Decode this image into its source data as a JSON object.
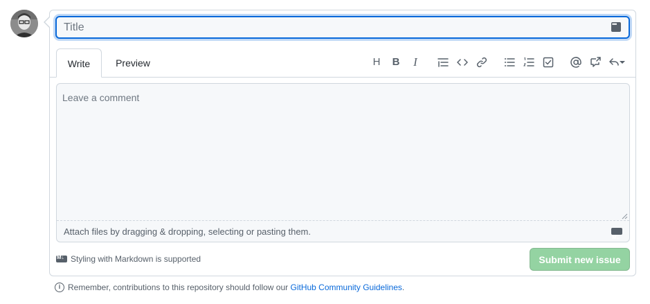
{
  "title_field": {
    "placeholder": "Title",
    "value": ""
  },
  "tabs": {
    "write": "Write",
    "preview": "Preview"
  },
  "toolbar": {
    "heading": "H",
    "bold": "B",
    "italic": "I",
    "items": [
      "heading-icon",
      "bold-icon",
      "italic-icon",
      "quote-icon",
      "code-icon",
      "link-icon",
      "bulleted-list-icon",
      "numbered-list-icon",
      "task-list-icon",
      "mention-icon",
      "cross-reference-icon",
      "reply-icon"
    ]
  },
  "comment": {
    "placeholder": "Leave a comment",
    "attach_hint": "Attach files by dragging & dropping, selecting or pasting them."
  },
  "markdown_note": "Styling with Markdown is supported",
  "submit_label": "Submit new issue",
  "footer": {
    "prefix": "Remember, contributions to this repository should follow our ",
    "link": "GitHub Community Guidelines",
    "suffix": "."
  },
  "colors": {
    "accent": "#0969da",
    "submit_disabled": "#94d3a2",
    "border": "#d0d7de"
  }
}
